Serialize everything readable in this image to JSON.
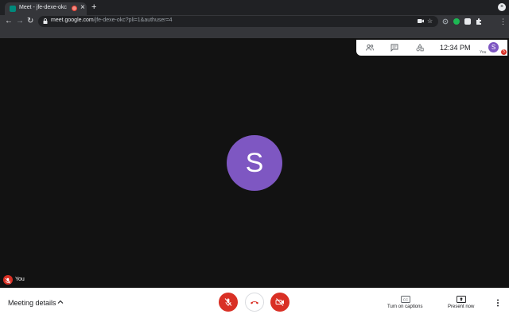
{
  "browser": {
    "tab_title": "Meet - jfe-dexe-okc",
    "tab_close": "×",
    "new_tab": "+",
    "window_close": "×",
    "url_host": "meet.google.com",
    "url_path": "/jfe-dexe-okc?pli=1&authuser=4",
    "back": "←",
    "forward": "→",
    "reload": "↻",
    "star": "☆",
    "menu": "⋮",
    "extensions_icon": "puzzle-icon"
  },
  "meeting": {
    "participant_initial": "S",
    "time": "12:34 PM",
    "self_label": "You",
    "self_initial": "S",
    "participant_badge": "5",
    "details_label": "Meeting details",
    "captions_label": "Turn on captions",
    "present_label": "Present now",
    "mic_muted": true,
    "camera_off": true
  },
  "colors": {
    "stage": "#121212",
    "avatar": "#7e57c2",
    "danger": "#d93025",
    "chrome_dark": "#202124",
    "chrome_toolbar": "#35363a"
  }
}
